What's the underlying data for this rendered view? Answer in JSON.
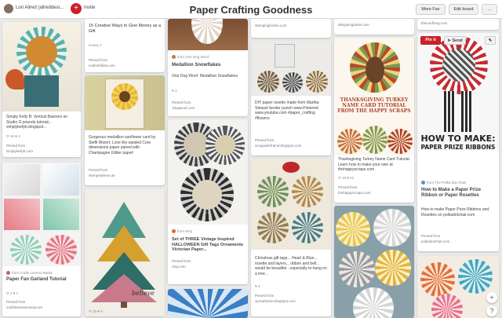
{
  "header": {
    "owner_name": "Lori Allred (allreddesi...",
    "invite_label": "Invite",
    "board_title": "Paper Crafting Goodness",
    "more_ideas_label": "More Fav",
    "edit_board_label": "Edit board",
    "more_menu_label": "..."
  },
  "pins": [
    {
      "id": "fall-banner",
      "desc": "Simply Kelly B: Vertical Banners on Studio G pounds tutorial... simplykellyb.blogspot...",
      "repins": "16",
      "likes": "1",
      "pinned_from_label": "Pinned from",
      "source": "simplykellyb.com"
    },
    {
      "id": "15-ways",
      "desc": "15 Creative Ways to Give Money as a Gift",
      "repins": "Honey 1",
      "pinned_from_label": "Pinned from",
      "source": "multiofofiats.com"
    },
    {
      "id": "snowflakes",
      "pinner": "from One Dog Woof",
      "title": "Medallion Snowflakes",
      "desc": "One Dog Woof: Medallion Snowflakes",
      "likes": "1",
      "pinned_from_label": "Pinned from",
      "source": "1dogwoof.com"
    },
    {
      "id": "rosette-punch",
      "desc": "DIY paper rosette made from Martha Stewart border punch www.Pinterest www.youtube.com #paper_crafting #flowers",
      "pinned_from_label": "Pinned from",
      "source": "scrapadrirfriend.blogspot.com"
    },
    {
      "id": "turkey",
      "desc": "Thanksgiving Turkey Name Card Tutorial. Learn how to make your own at thehappyscraps.com",
      "likes": "18",
      "repins": "12",
      "pinned_from_label": "Pinned from",
      "source": "thehappyscraps.com",
      "image_text": "THANKSGIVING TURKEY NAME CARD TUTORIAL FROM THE HAPPY SCRAPS"
    },
    {
      "id": "prize-ribbons",
      "hl1": "HOW TO MAKE:",
      "hl2": "PAPER PRIZE RIBBONS",
      "title": "How to Make a Paper Prize Ribbon or Paper Rosettes",
      "pinner": "from The Polka Dot Chair",
      "desc": "How to make Paper Prize Ribbons and Rosettes on polkadotchair.com",
      "pinned_from_label": "Pinned from",
      "source": "polkadotchair.com",
      "pin_it_label": "Pin it",
      "send_label": "Send"
    },
    {
      "id": "sunflower",
      "desc": "Gorgeous medallion sunflower card by Steffi Ritzert. Love the sanded Core dimensions paper paired with Champagne Glitter paper!",
      "pinned_from_label": "Pinned from",
      "source": "stempelwiese.de"
    },
    {
      "id": "halloween",
      "pinner": "from Etsy",
      "desc": "Set of THREE Vintage Inspired HALLOWEEN Gift Tags Ornaments Victorian Paper...",
      "pinned_from_label": "Pinned from",
      "source": "etsy.com"
    },
    {
      "id": "gift-tags",
      "desc": "Christmas gift tags... Heart & Blue... rosette and layers... ribbon and bell... would be beautiful - especially to hang on a tree...",
      "likes": "4",
      "pinned_from_label": "Pinned from",
      "source": "sprouthome.blogspot.com"
    },
    {
      "id": "fan-garland",
      "pinner": "from Crafts Lesson Mania",
      "title": "Paper Fan Garland Tutorial",
      "repins": "2",
      "likes": "1",
      "pinned_from_label": "Pinned from",
      "source": "craftslessonsmania.net"
    },
    {
      "id": "paper-tree",
      "image_text": "believe",
      "repins": "15",
      "likes": "4"
    },
    {
      "id": "top-left-top",
      "source": "designingideas.com"
    },
    {
      "id": "top-mid",
      "source": "stampingfunfun.com"
    },
    {
      "id": "top-right",
      "source": "tfavourfieng.com"
    }
  ],
  "controls": {
    "add_label": "+",
    "help_label": "?"
  }
}
